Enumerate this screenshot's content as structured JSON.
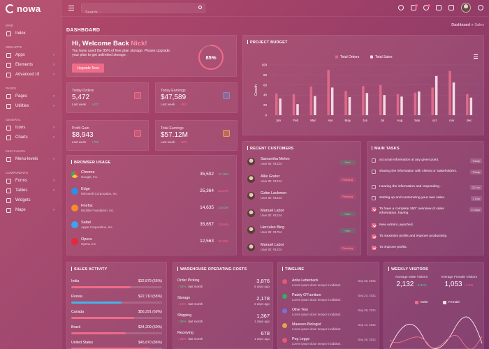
{
  "brand": {
    "name": "nowa"
  },
  "search": {
    "placeholder": "Search..."
  },
  "sidebar": {
    "sections": [
      {
        "title": "MAIN",
        "items": [
          {
            "label": "Index",
            "chevron": false
          }
        ]
      },
      {
        "title": "WEB APPS",
        "items": [
          {
            "label": "Apps",
            "chevron": true
          },
          {
            "label": "Elements",
            "chevron": true
          },
          {
            "label": "Advanced UI",
            "chevron": true
          }
        ]
      },
      {
        "title": "PAGES",
        "items": [
          {
            "label": "Pages",
            "chevron": true
          },
          {
            "label": "Utilities",
            "chevron": true
          }
        ]
      },
      {
        "title": "GENERAL",
        "items": [
          {
            "label": "Icons",
            "chevron": true
          },
          {
            "label": "Charts",
            "chevron": true
          }
        ]
      },
      {
        "title": "MULTI LEVEL",
        "items": [
          {
            "label": "Menu-levels",
            "chevron": true
          }
        ]
      },
      {
        "title": "COMPONENTS",
        "items": [
          {
            "label": "Forms",
            "chevron": true
          },
          {
            "label": "Tables",
            "chevron": true
          },
          {
            "label": "Widgets",
            "chevron": false
          },
          {
            "label": "Maps",
            "chevron": true
          }
        ]
      }
    ]
  },
  "page": {
    "title": "DASHBOARD",
    "breadcrumb": [
      "Dashboard",
      "Sales"
    ]
  },
  "welcome": {
    "greeting": "Hi, Welcome Back ",
    "name": "Nick!",
    "text": "You have used the 85% of free plan storage. Please upgrade your plan to get unlimited storage.",
    "button": "Upgrade Now",
    "progress_label": "85%",
    "progress": 0.85
  },
  "stats": [
    {
      "label": "Today Orders",
      "value": "5,472",
      "sub": "Last week",
      "trend": "+427",
      "dir": "up",
      "icon": "cart-icon",
      "box_color": "#ee6c88"
    },
    {
      "label": "Today Earnings",
      "value": "$47,589",
      "sub": "Last week",
      "trend": "-453",
      "dir": "down",
      "icon": "dollar-icon",
      "box_color": "#7c8fc9"
    },
    {
      "label": "Profit Gain",
      "value": "$8,943",
      "sub": "Last week",
      "trend": "+788",
      "dir": "up",
      "icon": "export-icon",
      "box_color": "#ee6c88"
    },
    {
      "label": "Total Earnings",
      "value": "$57.12M",
      "sub": "Last week",
      "trend": "-693",
      "dir": "down",
      "icon": "wallet-icon",
      "box_color": "#e8a34a"
    }
  ],
  "budget": {
    "title": "PROJECT BUDGET",
    "legend": [
      "Total Orders",
      "Total Sales"
    ]
  },
  "chart_data": {
    "type": "bar",
    "title": "PROJECT BUDGET",
    "ylabel": "Growth",
    "ylim": [
      0,
      100
    ],
    "yticks": [
      0,
      20,
      40,
      60,
      80,
      100
    ],
    "categories": [
      "Jan",
      "Feb",
      "Mar",
      "Apr",
      "May",
      "Jun",
      "Jul",
      "Aug",
      "Sep",
      "oct",
      "nov",
      "dec"
    ],
    "series": [
      {
        "name": "Total Orders",
        "color": "#e06a8a",
        "values": [
          43,
          42,
          57,
          90,
          48,
          58,
          60,
          42,
          45,
          55,
          88,
          42
        ]
      },
      {
        "name": "Total Sales",
        "color": "#f3dbe2",
        "values": [
          33,
          22,
          38,
          55,
          36,
          44,
          40,
          37,
          47,
          78,
          65,
          35
        ]
      }
    ]
  },
  "browser": {
    "title": "BROWSER USAGE",
    "rows": [
      {
        "name": "Chrome",
        "company": "Google, Inc.",
        "value": "35,502",
        "pct": "12.75%",
        "dir": "up",
        "icon": "chrome-icon",
        "color": "#e8453c"
      },
      {
        "name": "Edge",
        "company": "Microsoft Corporation, Inc.",
        "value": "25,364",
        "pct": "24.37%",
        "dir": "down",
        "icon": "edge-icon",
        "color": "#2f8ee0"
      },
      {
        "name": "Firefox",
        "company": "Mozilla Foundation, Inc.",
        "value": "14,635",
        "pct": "15.63%",
        "dir": "up",
        "icon": "firefox-icon",
        "color": "#f58b2b"
      },
      {
        "name": "Safari",
        "company": "Apple Corporation, Inc.",
        "value": "35,657",
        "pct": "12.54%",
        "dir": "down",
        "icon": "safari-icon",
        "color": "#3aa5f0"
      },
      {
        "name": "Opera",
        "company": "Opera, Inc.",
        "value": "12,563",
        "pct": "15.12%",
        "dir": "down",
        "icon": "opera-icon",
        "color": "#e32a3b"
      }
    ]
  },
  "customers": {
    "title": "RECENT CUSTOMERS",
    "rows": [
      {
        "name": "Samantha Melon",
        "id": "User ID: #1234",
        "status": "Paid",
        "color": "#3aa86b"
      },
      {
        "name": "Allie Grater",
        "id": "User ID: #1234",
        "status": "Pending",
        "color": "#e85874"
      },
      {
        "name": "Gabe Lackmen",
        "id": "User ID: #1234",
        "status": "Pending",
        "color": "#e85874"
      },
      {
        "name": "Manuel Labor",
        "id": "User ID: #1234",
        "status": "Paid",
        "color": "#3aa86b"
      },
      {
        "name": "Hercules Bing",
        "id": "User ID: #1754",
        "status": "Paid",
        "color": "#3aa86b"
      },
      {
        "name": "Manuel Labor",
        "id": "User ID: #1234",
        "status": "Pending",
        "color": "#e85874"
      }
    ]
  },
  "tasks": {
    "title": "MAIN TASKS",
    "rows": [
      {
        "text": "accurate information at any given point.",
        "done": false,
        "badge": "Today"
      },
      {
        "text": "sharing the information with clients or stakeholders.",
        "done": false,
        "badge": "Today"
      },
      {
        "text": "Hearing the information and responding .",
        "done": false,
        "badge": "22 hrs"
      },
      {
        "text": "Setting up and customizing your own sales.",
        "done": false,
        "badge": "1 Day"
      },
      {
        "text": "To have a complete 360° overview of sales information, having.",
        "done": true,
        "badge": "2 Days"
      },
      {
        "text": "New Admin Launched.",
        "done": true,
        "badge": ""
      },
      {
        "text": "To maximize profits and improve productivity.",
        "done": true,
        "badge": ""
      },
      {
        "text": "To improve profits.",
        "done": true,
        "badge": ""
      }
    ]
  },
  "sales": {
    "title": "SALES ACTIVITY",
    "rows": [
      {
        "country": "India",
        "value": "$32,879 (65%)",
        "pct": 65,
        "color": "#ee6c88"
      },
      {
        "country": "Russia",
        "value": "$22,710 (55%)",
        "pct": 55,
        "color": "#45b4e8"
      },
      {
        "country": "Canada",
        "value": "$56,291 (69%)",
        "pct": 69,
        "color": "#ee6c88"
      },
      {
        "country": "Brazil",
        "value": "$34,209 (60%)",
        "pct": 60,
        "color": "#ee6c88"
      },
      {
        "country": "United States",
        "value": "$45,870 (86%)",
        "pct": 86,
        "color": "#ee6c88"
      }
    ]
  },
  "warehouse": {
    "title": "WAREHOUSE OPERATING COSTS",
    "rows": [
      {
        "name": "Order Picking",
        "value": "3,876",
        "trend": "↑ 03%",
        "dir": "up",
        "sub": "last month",
        "ago": "5 days ago"
      },
      {
        "name": "Storage",
        "value": "2,178",
        "trend": "↓ 16%",
        "dir": "down",
        "sub": "last month",
        "ago": "2 days ago"
      },
      {
        "name": "Shipping",
        "value": "1,367",
        "trend": "↑ 06%",
        "dir": "up",
        "sub": "last month",
        "ago": "1 days ago"
      },
      {
        "name": "Receiving",
        "value": "678",
        "trend": "↓ 25%",
        "dir": "down",
        "sub": "last month",
        "ago": "1 days ago"
      }
    ]
  },
  "timeline": {
    "title": "TIMELINE",
    "rows": [
      {
        "name": "Anita Letterback",
        "desc": "Lorem ipsum dolor tempor incididunt .",
        "date": "Sep 26, 2021",
        "color": "#e85874"
      },
      {
        "name": "Paddy O'Furniture",
        "desc": "Lorem ipsum dolor tempor incididunt .",
        "date": "Sep 24, 2021",
        "color": "#3aa86b"
      },
      {
        "name": "Olive Yew",
        "desc": "Lorem ipsum dolor tempor incididunt .",
        "date": "Sep 28, 2021",
        "color": "#7c6fd8"
      },
      {
        "name": "Maureen Biologist",
        "desc": "Lorem ipsum dolor tempor incididunt .",
        "date": "Sep 14, 2021",
        "color": "#e8a34a"
      },
      {
        "name": "Peg Legge",
        "desc": "Lorem ipsum dolor tempor incididunt .",
        "date": "Sep 28, 2021",
        "color": "#e85874"
      }
    ]
  },
  "visitors": {
    "title": "WEEKLY VISITORS",
    "male_label": "Average Male Visitors",
    "male_value": "2,132",
    "male_trend": "↑ 0.04%",
    "female_label": "Average Female Visitors",
    "female_value": "1,053",
    "female_trend": "↓ 1.4%",
    "legend": [
      "Male",
      "Female"
    ]
  }
}
